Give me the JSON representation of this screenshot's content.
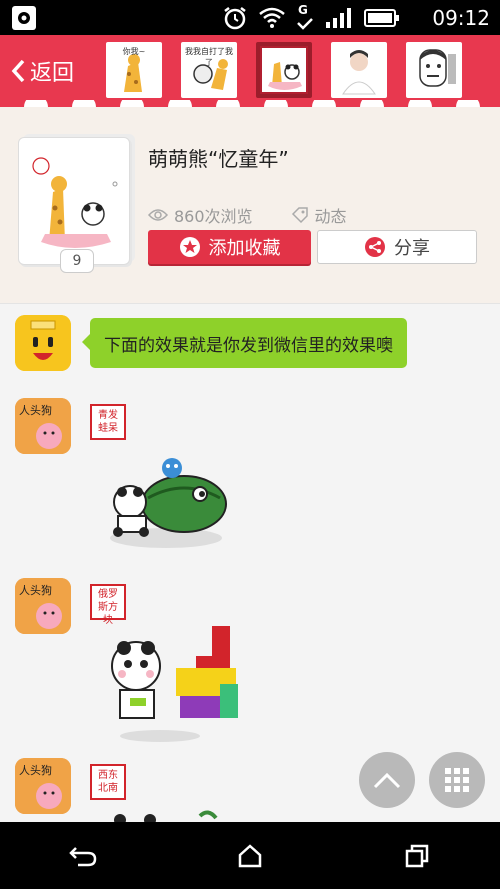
{
  "status_bar": {
    "time": "09:12",
    "network_label": "G",
    "icons": [
      "settings-icon",
      "alarm-icon",
      "wifi-icon",
      "signal-icon",
      "battery-icon"
    ]
  },
  "nav": {
    "back_label": "返回",
    "thumbnails": [
      {
        "caption": "你我~"
      },
      {
        "caption": "我我自打了我了"
      },
      {
        "caption": ""
      },
      {
        "caption": ""
      },
      {
        "caption": ""
      }
    ],
    "active_thumbnail_index": 2
  },
  "pack": {
    "title": "萌萌熊“忆童年”",
    "count": "9",
    "views": "860次浏览",
    "tag": "动态",
    "favorite_label": "添加收藏",
    "share_label": "分享"
  },
  "chat": {
    "intro_text": "下面的效果就是你发到微信里的效果噢",
    "sender_avatar_text": "人头狗",
    "messages": [
      {
        "seal_text": "青发蛙呆"
      },
      {
        "seal_text": "俄罗斯方块"
      },
      {
        "seal_text": "西东北南"
      }
    ]
  },
  "colors": {
    "brand": "#e8384f",
    "bubble": "#8ed12a",
    "header_bg": "#f6f0ea"
  }
}
